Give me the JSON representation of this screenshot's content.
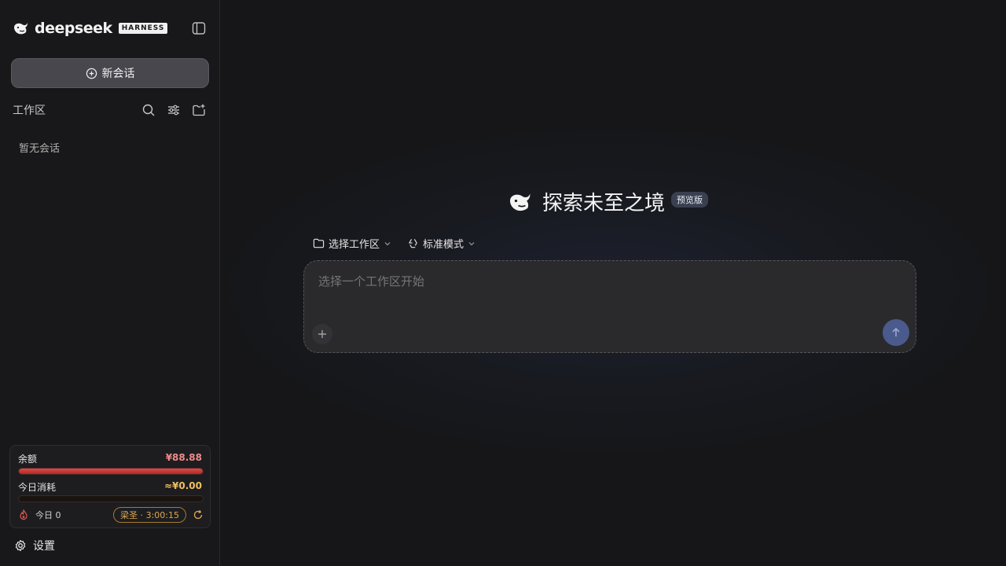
{
  "sidebar": {
    "brand": {
      "wordmark": "deepseek",
      "badge": "HARNESS"
    },
    "new_chat_label": "新会话",
    "workspace_title": "工作区",
    "empty_text": "暂无会话",
    "balance": {
      "balance_label": "余额",
      "balance_value": "¥88.88",
      "balance_fill": 1.0,
      "today_label": "今日消耗",
      "today_value": "≈¥0.00",
      "today_fill": 0.0,
      "today_count": "今日 0",
      "timer_badge": "梁圣 · 3:00:15"
    },
    "settings_label": "设置"
  },
  "main": {
    "hero_title": "探索未至之境",
    "preview_badge": "预览版",
    "workspace_select": "选择工作区",
    "mode_select": "标准模式",
    "composer_placeholder": "选择一个工作区开始"
  },
  "colors": {
    "accent_send": "#4a5a8c",
    "balance_red": "#ef8a8a",
    "today_yellow": "#f0c060",
    "badge_orange": "#e0a850"
  }
}
